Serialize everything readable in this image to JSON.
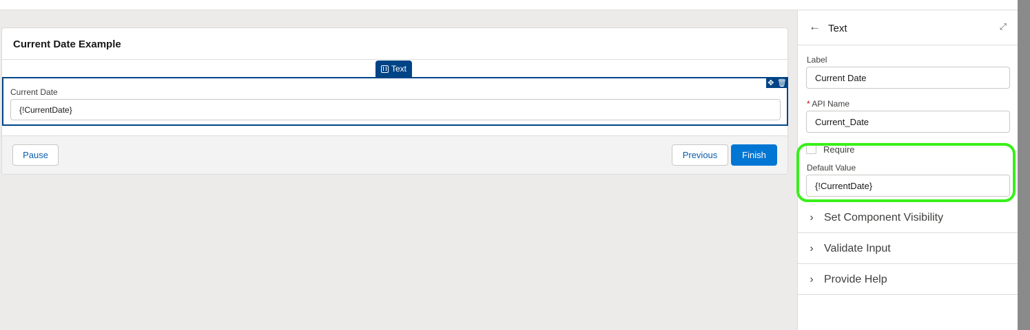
{
  "screen": {
    "title": "Current Date Example",
    "component_tag": "Text",
    "field_label": "Current Date",
    "field_value": "{!CurrentDate}",
    "buttons": {
      "pause": "Pause",
      "previous": "Previous",
      "finish": "Finish"
    }
  },
  "panel": {
    "title": "Text",
    "label_caption": "Label",
    "label_value": "Current Date",
    "api_name_caption": "API Name",
    "api_name_value": "Current_Date",
    "require_label": "Require",
    "require_checked": false,
    "default_value_caption": "Default Value",
    "default_value": "{!CurrentDate}",
    "sections": [
      {
        "label": "Set Component Visibility"
      },
      {
        "label": "Validate Input"
      },
      {
        "label": "Provide Help"
      }
    ]
  },
  "colors": {
    "highlight": "#39ef1a",
    "brand": "#0176d3",
    "component_selected": "#014486"
  },
  "icons": [
    "back-arrow-icon",
    "expand-icon",
    "text-component-icon",
    "move-icon",
    "trash-icon",
    "chevron-right-icon"
  ]
}
